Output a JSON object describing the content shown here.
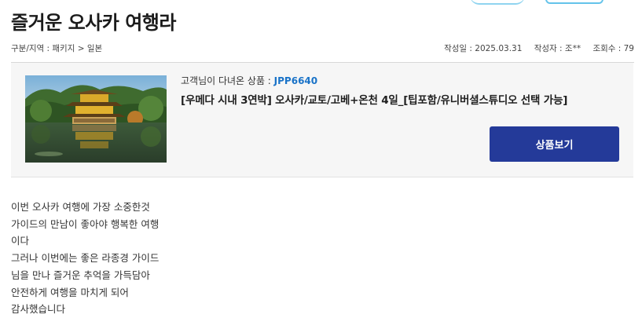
{
  "post": {
    "title": "즐거운 오사카 여행라",
    "breadcrumb": "구분/지역 : 패키지 > 일본",
    "date": "작성일 : 2025.03.31",
    "author": "작성자 : 조**",
    "views": "조회수 : 79"
  },
  "product": {
    "label": "고객님이 다녀온 상품 : ",
    "code": "JPP6640",
    "title": "[우메다 시내 3연박] 오사카/교토/고베+온천 4일_[팁포함/유니버셜스튜디오 선택 가능]",
    "button_label": "상품보기",
    "button_color": "#243a99",
    "code_color": "#1a73c8"
  },
  "content": {
    "lines": [
      "이번 오사카 여행에 가장 소중한것",
      "가이드의 만남이 좋아야 행복한 여행",
      "이다",
      "그러나 이번에는 좋은 라종경 가이드",
      "님을 만나 즐거운 추억을 가득담아",
      "안전하게 여행을 마치게 되어",
      "감사했습니다"
    ]
  }
}
